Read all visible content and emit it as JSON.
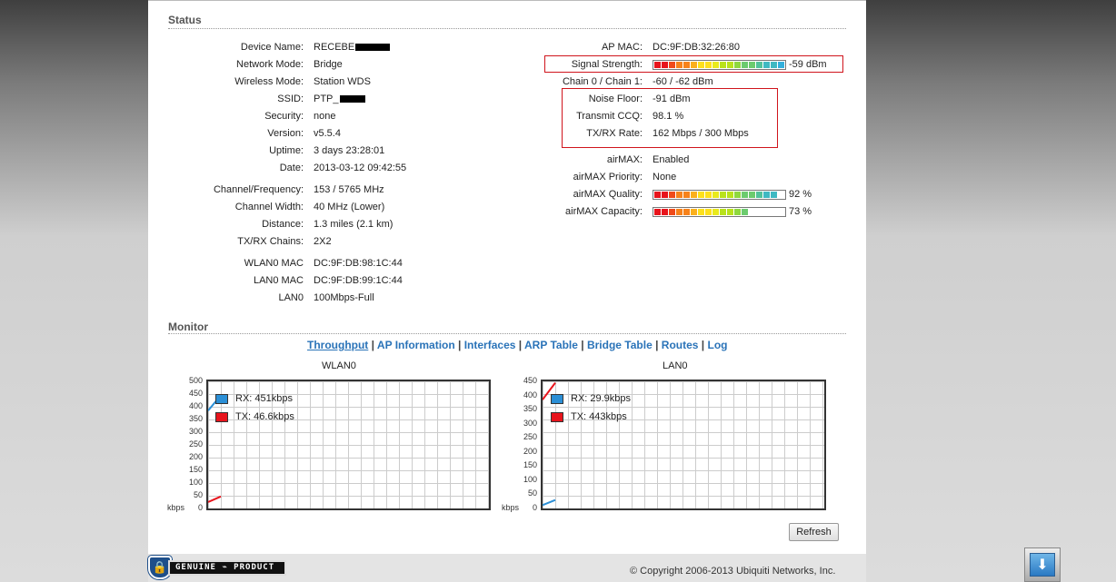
{
  "status": {
    "title": "Status",
    "left": [
      {
        "label": "Device Name:",
        "value": "RECEBE"
      },
      {
        "label": "Network Mode:",
        "value": "Bridge"
      },
      {
        "label": "Wireless Mode:",
        "value": "Station WDS"
      },
      {
        "label": "SSID:",
        "value": "PTP_"
      },
      {
        "label": "Security:",
        "value": "none"
      },
      {
        "label": "Version:",
        "value": "v5.5.4"
      },
      {
        "label": "Uptime:",
        "value": "3 days 23:28:01"
      },
      {
        "label": "Date:",
        "value": "2013-03-12 09:42:55"
      },
      {
        "label": "Channel/Frequency:",
        "value": "153 / 5765 MHz"
      },
      {
        "label": "Channel Width:",
        "value": "40 MHz (Lower)"
      },
      {
        "label": "Distance:",
        "value": "1.3 miles (2.1 km)"
      },
      {
        "label": "TX/RX Chains:",
        "value": "2X2"
      },
      {
        "label": "WLAN0 MAC",
        "value": "DC:9F:DB:98:1C:44"
      },
      {
        "label": "LAN0 MAC",
        "value": "DC:9F:DB:99:1C:44"
      },
      {
        "label": "LAN0",
        "value": "100Mbps-Full"
      }
    ],
    "right": [
      {
        "label": "AP MAC:",
        "value": "DC:9F:DB:32:26:80"
      },
      {
        "label": "Signal Strength:",
        "value": "-59 dBm"
      },
      {
        "label": "Chain 0 / Chain 1:",
        "value": "-60 / -62 dBm"
      },
      {
        "label": "Noise Floor:",
        "value": "-91 dBm"
      },
      {
        "label": "Transmit CCQ:",
        "value": "98.1 %"
      },
      {
        "label": "TX/RX Rate:",
        "value": "162 Mbps / 300 Mbps"
      },
      {
        "label": "airMAX:",
        "value": "Enabled"
      },
      {
        "label": "airMAX Priority:",
        "value": "None"
      },
      {
        "label": "airMAX Quality:",
        "value": "92 %"
      },
      {
        "label": "airMAX Capacity:",
        "value": "73 %"
      }
    ],
    "meters": {
      "signal_level": 1.0,
      "quality_level": 0.92,
      "capacity_level": 0.73,
      "colors": [
        "#e8141c",
        "#f04a1a",
        "#f7821a",
        "#fbb01c",
        "#fde01c",
        "#e9ea1c",
        "#b9e21c",
        "#8fd83e",
        "#6ccb6e",
        "#52c29a",
        "#3fb9c2",
        "#33b0dc"
      ]
    }
  },
  "monitor": {
    "title": "Monitor",
    "tabs": [
      "Throughput",
      "AP Information",
      "Interfaces",
      "ARP Table",
      "Bridge Table",
      "Routes",
      "Log"
    ],
    "active_tab": "Throughput",
    "refresh_label": "Refresh"
  },
  "chart_data": [
    {
      "type": "line",
      "title": "WLAN0",
      "ylabel": "kbps",
      "ylim": [
        0,
        500
      ],
      "yticks": [
        0,
        50,
        100,
        150,
        200,
        250,
        300,
        350,
        400,
        450,
        500
      ],
      "series": [
        {
          "name": "RX",
          "legend": "RX: 451kbps",
          "color": "#2b8fd6",
          "values": [
            385,
            445
          ]
        },
        {
          "name": "TX",
          "legend": "TX: 46.6kbps",
          "color": "#e8141c",
          "values": [
            25,
            47
          ]
        }
      ]
    },
    {
      "type": "line",
      "title": "LAN0",
      "ylabel": "kbps",
      "ylim": [
        0,
        450
      ],
      "yticks": [
        0,
        50,
        100,
        150,
        200,
        250,
        300,
        350,
        400,
        450
      ],
      "series": [
        {
          "name": "RX",
          "legend": "RX: 29.9kbps",
          "color": "#2b8fd6",
          "values": [
            12,
            30
          ]
        },
        {
          "name": "TX",
          "legend": "TX: 443kbps",
          "color": "#e8141c",
          "values": [
            385,
            445
          ]
        }
      ]
    }
  ],
  "footer": {
    "copyright": "© Copyright 2006-2013 Ubiquiti Networks, Inc.",
    "logo_text": "GENUINE ⌁ PRODUCT"
  }
}
